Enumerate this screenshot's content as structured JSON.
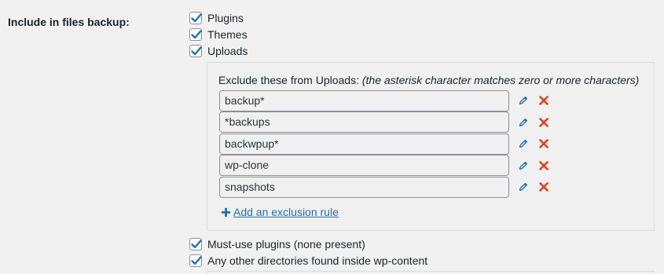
{
  "setting": {
    "label": "Include in files backup:"
  },
  "options": {
    "plugins": "Plugins",
    "themes": "Themes",
    "uploads": "Uploads",
    "mu_plugins": "Must-use plugins (none present)",
    "other_dirs": "Any other directories found inside wp-content"
  },
  "exclusions": {
    "title": "Exclude these from Uploads:",
    "hint": "(the asterisk character matches zero or more characters)",
    "rules": [
      "backup*",
      "*backups",
      "backwpup*",
      "wp-clone",
      "snapshots"
    ],
    "add_label": "Add an exclusion rule"
  },
  "colors": {
    "check": "#2271b1",
    "link": "#2271b1",
    "delete": "#e2401c"
  },
  "icons": {
    "edit": "pencil-icon",
    "delete": "x-icon",
    "add": "plus-icon"
  }
}
